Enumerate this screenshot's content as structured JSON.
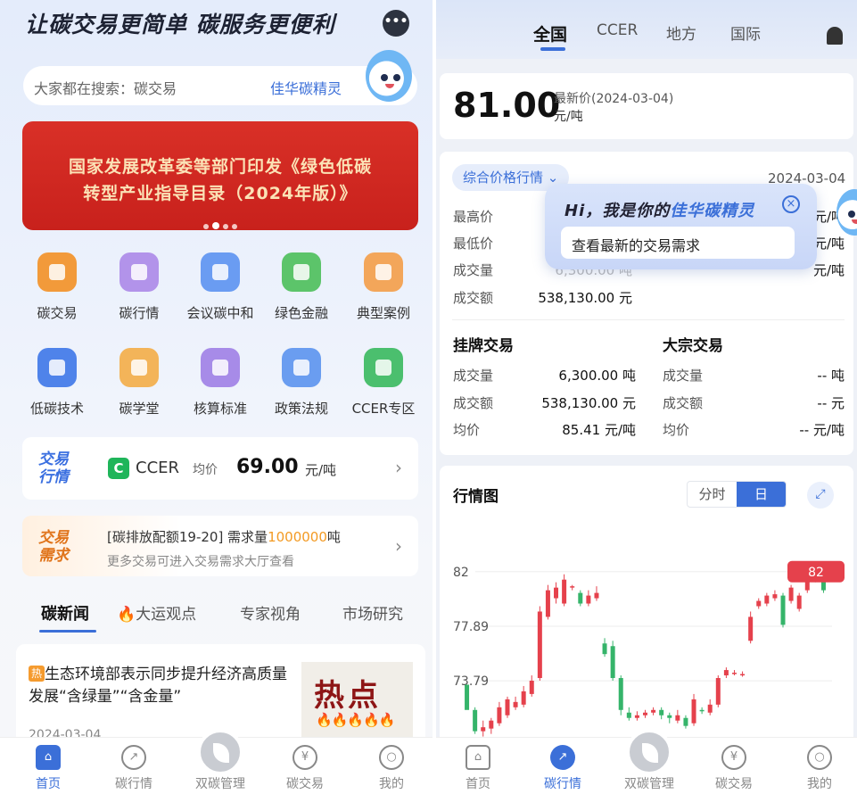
{
  "left": {
    "headline": "让碳交易更简单 碳服务更便利",
    "chat_icon": "•••",
    "search": {
      "placeholder": "大家都在搜索：碳交易",
      "link": "佳华碳精灵"
    },
    "banner": {
      "line1": "国家发展改革委等部门印发《绿色低碳",
      "line2": "转型产业指导目录（2024年版）》"
    },
    "grid": [
      {
        "label": "碳交易",
        "icon": "exchange-icon",
        "color": "#f29a3a"
      },
      {
        "label": "碳行情",
        "icon": "market-chart-icon",
        "color": "#b293ea"
      },
      {
        "label": "会议碳中和",
        "icon": "meeting-icon",
        "color": "#6a9cf2"
      },
      {
        "label": "绿色金融",
        "icon": "yuan-icon",
        "color": "#5cc46a"
      },
      {
        "label": "典型案例",
        "icon": "case-icon",
        "color": "#f3a65a"
      },
      {
        "label": "低碳技术",
        "icon": "tech-icon",
        "color": "#4f83ea"
      },
      {
        "label": "碳学堂",
        "icon": "school-icon",
        "color": "#f3b459"
      },
      {
        "label": "核算标准",
        "icon": "compass-icon",
        "color": "#a78be8"
      },
      {
        "label": "政策法规",
        "icon": "gavel-icon",
        "color": "#6a9df0"
      },
      {
        "label": "CCER专区",
        "icon": "ccer-icon",
        "color": "#4bbf6e"
      }
    ],
    "quote": {
      "tag_line1": "交易",
      "tag_line2": "行情",
      "logo": "C",
      "name": "CCER",
      "avg_label": "均价",
      "price": "69.00",
      "unit": "元/吨"
    },
    "demand": {
      "tag_line1": "交易",
      "tag_line2": "需求",
      "line1_prefix": "[碳排放配额19-20] 需求量",
      "line1_amount": "1000000",
      "line1_suffix": "吨",
      "line2": "更多交易可进入交易需求大厅查看"
    },
    "news_tabs": [
      "碳新闻",
      "大运观点",
      "专家视角",
      "市场研究"
    ],
    "news": {
      "badge": "热",
      "title": "生态环境部表示同步提升经济高质量发展“含绿量”“含金量”",
      "date": "2024-03-04",
      "thumb_text": "热点",
      "thumb_flames": "🔥🔥🔥🔥🔥"
    },
    "tabbar": [
      "首页",
      "碳行情",
      "双碳管理",
      "碳交易",
      "我的"
    ]
  },
  "right": {
    "top_tabs": [
      "全国",
      "CCER",
      "地方",
      "国际"
    ],
    "price": {
      "value": "81.00",
      "label": "最新价(2024-03-04)",
      "unit": "元/吨"
    },
    "stats": {
      "pill": "综合价格行情 ⌄",
      "date": "2024-03-04",
      "rows": [
        {
          "label": "最高价",
          "value": ""
        },
        {
          "label": "最低价",
          "value": ""
        },
        {
          "label": "成交量",
          "value": "6,300.00 吨"
        },
        {
          "label": "成交额",
          "value": "538,130.00 元"
        }
      ],
      "right_frag": [
        "元/吨",
        "元/吨",
        "元/吨"
      ],
      "listed": {
        "title": "挂牌交易",
        "rows": [
          {
            "label": "成交量",
            "value": "6,300.00 吨"
          },
          {
            "label": "成交额",
            "value": "538,130.00 元"
          },
          {
            "label": "均价",
            "value": "85.41 元/吨"
          }
        ]
      },
      "bulk": {
        "title": "大宗交易",
        "rows": [
          {
            "label": "成交量",
            "value": "-- 吨"
          },
          {
            "label": "成交额",
            "value": "-- 元"
          },
          {
            "label": "均价",
            "value": "-- 元/吨"
          }
        ]
      }
    },
    "popup": {
      "prefix": "Hi，我是你的",
      "name": "佳华碳精灵",
      "message": "查看最新的交易需求"
    },
    "chart_title": "行情图",
    "seg": [
      "分时",
      "日"
    ],
    "tabbar": [
      "首页",
      "碳行情",
      "双碳管理",
      "碳交易",
      "我的"
    ]
  },
  "chart_data": {
    "type": "candlestick",
    "title": "行情图",
    "y_ticks": [
      "82",
      "77.89",
      "73.79"
    ],
    "ylim": [
      68.5,
      84.6
    ],
    "last_price_label": "82",
    "colors": {
      "up": "#e5414c",
      "down": "#35b46a"
    },
    "candles": [
      [
        73.5,
        71.6,
        70.0,
        70.0
      ],
      [
        71.6,
        70.0,
        71.8,
        69.8
      ],
      [
        70.0,
        70.3,
        70.8,
        69.6
      ],
      [
        70.2,
        70.8,
        71.0,
        69.8
      ],
      [
        70.6,
        71.8,
        72.2,
        70.4
      ],
      [
        71.2,
        72.4,
        72.6,
        71.0
      ],
      [
        71.8,
        72.2,
        72.6,
        71.6
      ],
      [
        72.0,
        73.0,
        73.4,
        71.8
      ],
      [
        72.8,
        73.8,
        74.2,
        72.6
      ],
      [
        74.0,
        79.0,
        79.4,
        73.8
      ],
      [
        78.6,
        80.6,
        81.0,
        78.4
      ],
      [
        80.0,
        80.8,
        81.2,
        79.6
      ],
      [
        79.6,
        81.4,
        81.8,
        79.4
      ],
      [
        80.8,
        80.9,
        81.0,
        80.6
      ],
      [
        80.4,
        79.6,
        80.6,
        79.4
      ],
      [
        79.6,
        80.2,
        80.6,
        79.4
      ],
      [
        80.0,
        80.4,
        80.9,
        79.8
      ],
      [
        76.6,
        75.8,
        77.0,
        75.6
      ],
      [
        76.4,
        74.0,
        76.8,
        73.8
      ],
      [
        74.0,
        71.6,
        74.2,
        71.2
      ],
      [
        71.4,
        71.0,
        71.8,
        70.8
      ],
      [
        71.0,
        71.2,
        71.5,
        70.8
      ],
      [
        71.2,
        71.4,
        71.6,
        71.0
      ],
      [
        71.4,
        71.6,
        71.8,
        71.2
      ],
      [
        71.6,
        71.2,
        71.8,
        70.9
      ],
      [
        71.2,
        71.0,
        71.4,
        70.6
      ],
      [
        70.8,
        71.2,
        71.6,
        70.6
      ],
      [
        71.0,
        70.4,
        71.2,
        70.2
      ],
      [
        70.6,
        72.4,
        72.8,
        70.4
      ],
      [
        71.6,
        71.5,
        71.8,
        71.3
      ],
      [
        71.4,
        72.0,
        72.4,
        71.2
      ],
      [
        72.0,
        74.0,
        74.2,
        71.8
      ],
      [
        74.2,
        74.6,
        74.8,
        74.0
      ],
      [
        74.4,
        74.4,
        74.6,
        74.2
      ],
      [
        74.3,
        74.3,
        74.5,
        74.1
      ],
      [
        76.8,
        78.6,
        79.0,
        76.6
      ],
      [
        79.4,
        79.8,
        80.0,
        79.2
      ],
      [
        79.6,
        80.2,
        80.4,
        79.4
      ],
      [
        80.0,
        80.3,
        80.6,
        79.8
      ],
      [
        80.2,
        78.0,
        80.4,
        77.8
      ],
      [
        79.8,
        80.8,
        81.0,
        79.6
      ],
      [
        79.2,
        80.2,
        80.4,
        79.0
      ],
      [
        80.6,
        82.0,
        82.3,
        80.4
      ],
      [
        82.1,
        81.6,
        82.4,
        81.2
      ],
      [
        81.9,
        80.6,
        82.1,
        80.4
      ]
    ]
  }
}
